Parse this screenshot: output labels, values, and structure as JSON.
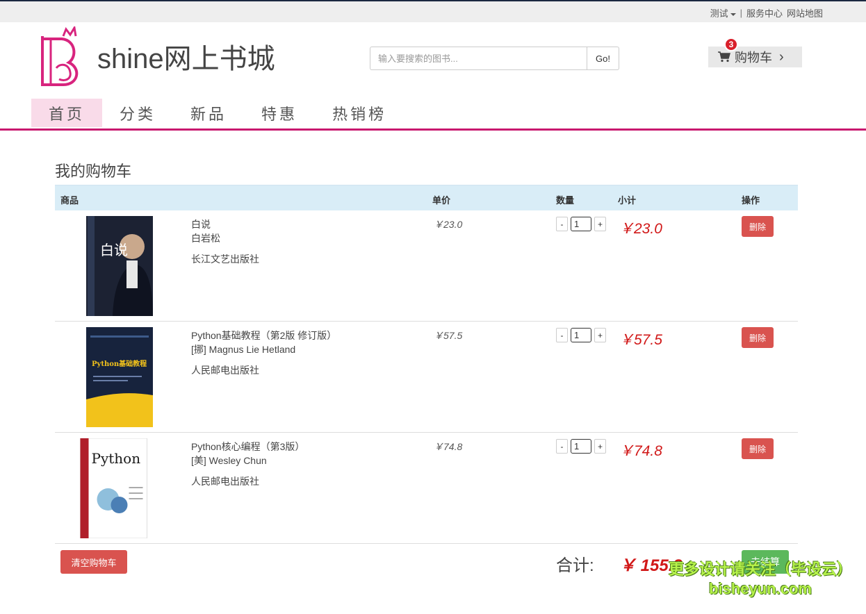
{
  "topbar": {
    "user": "测试",
    "separator": "|",
    "service": "服务中心",
    "sitemap": "网站地图"
  },
  "header": {
    "title": "shine网上书城",
    "search_placeholder": "输入要搜索的图书...",
    "search_button": "Go!",
    "cart_label": "购物车",
    "cart_count": "3"
  },
  "nav": {
    "items": [
      {
        "label": "首页",
        "active": true
      },
      {
        "label": "分类",
        "active": false
      },
      {
        "label": "新品",
        "active": false
      },
      {
        "label": "特惠",
        "active": false
      },
      {
        "label": "热销榜",
        "active": false
      }
    ]
  },
  "cart": {
    "heading": "我的购物车",
    "columns": {
      "product": "商品",
      "unit_price": "单价",
      "quantity": "数量",
      "subtotal": "小计",
      "action": "操作"
    },
    "items": [
      {
        "title": "白说",
        "author": "白岩松",
        "publisher": "长江文艺出版社",
        "unit_price": "￥23.0",
        "qty_minus": "-",
        "quantity": "1",
        "qty_plus": "+",
        "subtotal": "￥23.0",
        "delete": "删除",
        "cover_text": "白说"
      },
      {
        "title": "Python基础教程（第2版 修订版）",
        "author": "[挪] Magnus Lie Hetland",
        "publisher": "人民邮电出版社",
        "unit_price": "￥57.5",
        "qty_minus": "-",
        "quantity": "1",
        "qty_plus": "+",
        "subtotal": "￥57.5",
        "delete": "删除",
        "cover_text": "Python基础教程"
      },
      {
        "title": "Python核心编程（第3版）",
        "author": "[美] Wesley Chun",
        "publisher": "人民邮电出版社",
        "unit_price": "￥74.8",
        "qty_minus": "-",
        "quantity": "1",
        "qty_plus": "+",
        "subtotal": "￥74.8",
        "delete": "删除",
        "cover_text": "Python"
      }
    ],
    "clear_button": "清空购物车",
    "total_label": "合计:",
    "total_value": "￥ 155.3",
    "checkout_button": "去结算"
  },
  "watermark": {
    "line1": "更多设计请关注（毕设云）",
    "line2": "bisheyun.com"
  },
  "colors": {
    "brand": "#c8186e",
    "price": "#d11818",
    "danger": "#d9534f",
    "success": "#5cb85c",
    "table_header": "#d9edf7"
  }
}
